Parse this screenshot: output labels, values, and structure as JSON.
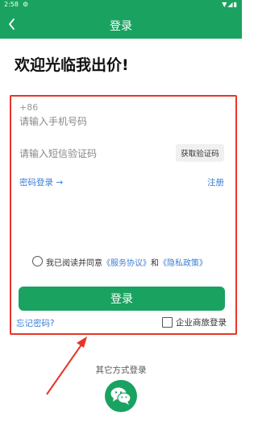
{
  "status_bar": {
    "time": "2:58",
    "settings_icon": "gear-icon",
    "right_icons": "▼◢▮"
  },
  "nav": {
    "title": "登录",
    "back_icon": "chevron-left-icon"
  },
  "welcome_text": "欢迎光临我出价!",
  "form": {
    "country_code": "+86",
    "phone_placeholder": "请输入手机号码",
    "code_placeholder": "请输入短信验证码",
    "get_code_label": "获取验证码",
    "password_login_label": "密码登录 →",
    "register_label": "注册"
  },
  "agreement": {
    "prefix": "我已阅读并同意",
    "service_link": "《服务协议》",
    "and": "和",
    "privacy_link": "《隐私政策》"
  },
  "login_button_label": "登录",
  "forgot_password_label": "忘记密码?",
  "enterprise_login_label": "企业商旅登录",
  "other_login_label": "其它方式登录",
  "colors": {
    "brand_green": "#1aa260",
    "link_blue": "#3a7fd5",
    "annotation_red": "#e8352a"
  }
}
